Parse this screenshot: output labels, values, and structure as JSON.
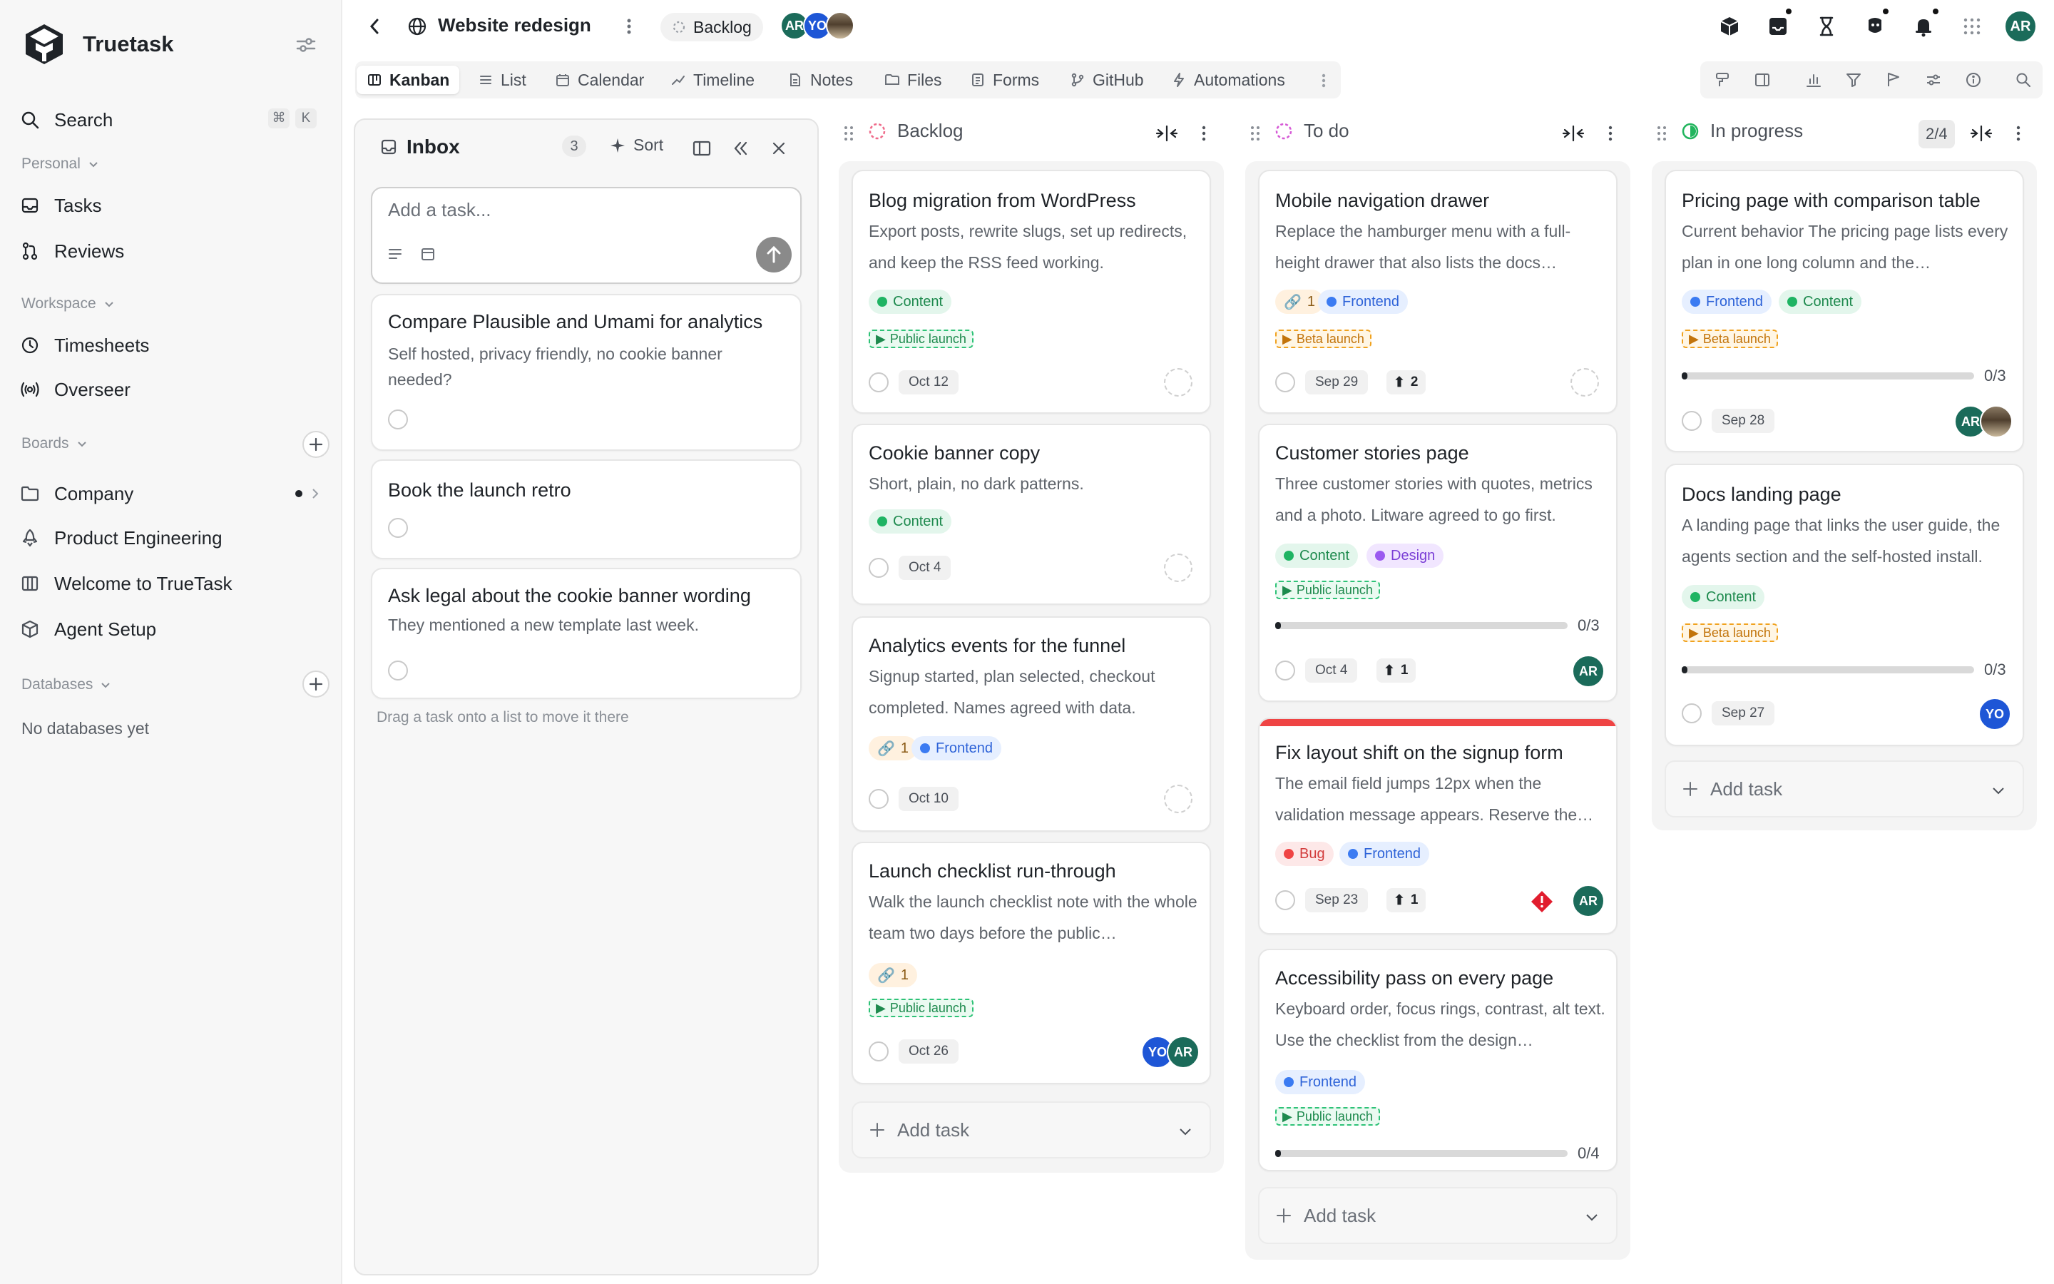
{
  "sidebar": {
    "brand": "Truetask",
    "search_label": "Search",
    "search_kbd": [
      "⌘",
      "K"
    ],
    "personal_label": "Personal",
    "personal_items": [
      {
        "label": "Tasks"
      },
      {
        "label": "Reviews"
      }
    ],
    "workspace_label": "Workspace",
    "workspace_items": [
      {
        "label": "Timesheets"
      },
      {
        "label": "Overseer"
      }
    ],
    "boards_label": "Boards",
    "boards": [
      {
        "label": "Company"
      },
      {
        "label": "Product Engineering"
      },
      {
        "label": "Welcome to TrueTask"
      },
      {
        "label": "Agent Setup"
      }
    ],
    "databases_label": "Databases",
    "databases_empty": "No databases yet"
  },
  "topbar": {
    "title": "Website redesign",
    "status_pill": "Backlog",
    "members": [
      "AR",
      "YO"
    ],
    "user_initials": "AR"
  },
  "views": {
    "tabs": [
      {
        "label": "Kanban",
        "active": true
      },
      {
        "label": "List"
      },
      {
        "label": "Calendar"
      },
      {
        "label": "Timeline"
      },
      {
        "label": "Notes"
      },
      {
        "label": "Files"
      },
      {
        "label": "Forms"
      },
      {
        "label": "GitHub"
      },
      {
        "label": "Automations"
      }
    ]
  },
  "inbox": {
    "title": "Inbox",
    "count": "3",
    "sort_label": "Sort",
    "add_placeholder": "Add a task...",
    "cards": [
      {
        "title": "Compare Plausible and Umami for analytics",
        "desc": "Self hosted, privacy friendly, no cookie banner needed?"
      },
      {
        "title": "Book the launch retro",
        "desc": ""
      },
      {
        "title": "Ask legal about the cookie banner wording",
        "desc": "They mentioned a new template last week."
      }
    ],
    "hint": "Drag a task onto a list to move it there"
  },
  "columns": {
    "backlog": {
      "title": "Backlog",
      "cards": [
        {
          "title": "Blog migration from WordPress",
          "desc": "Export posts, rewrite slugs, set up redirects, and keep the RSS feed working.",
          "tags": [
            "Content"
          ],
          "milestone": "Public launch",
          "date": "Oct 12"
        },
        {
          "title": "Cookie banner copy",
          "desc": "Short, plain, no dark patterns.",
          "tags": [
            "Content"
          ],
          "date": "Oct 4"
        },
        {
          "title": "Analytics events for the funnel",
          "desc": "Signup started, plan selected, checkout completed. Names agreed with data.",
          "links": "1",
          "tags": [
            "Frontend"
          ],
          "date": "Oct 10"
        },
        {
          "title": "Launch checklist run-through",
          "desc": "Walk the launch checklist note with the whole team two days before the public…",
          "links": "1",
          "milestone": "Public launch",
          "date": "Oct 26",
          "assignees": [
            "YO",
            "AR"
          ]
        }
      ],
      "add_label": "Add task"
    },
    "todo": {
      "title": "To do",
      "cards": [
        {
          "title": "Mobile navigation drawer",
          "desc": "Replace the hamburger menu with a full-height drawer that also lists the docs…",
          "links": "1",
          "tags": [
            "Frontend"
          ],
          "milestone": "Beta launch",
          "date": "Sep 29",
          "votes": "2"
        },
        {
          "title": "Customer stories page",
          "desc": "Three customer stories with quotes, metrics and a photo. Litware agreed to go first.",
          "tags": [
            "Content",
            "Design"
          ],
          "milestone": "Public launch",
          "progress": "0/3",
          "progress_value": 0,
          "date": "Oct 4",
          "votes": "1",
          "assignees": [
            "AR"
          ]
        },
        {
          "title": "Fix layout shift on the signup form",
          "desc": "The email field jumps 12px when the validation message appears. Reserve the…",
          "tags": [
            "Bug",
            "Frontend"
          ],
          "date": "Sep 23",
          "votes": "1",
          "assignees": [
            "AR"
          ]
        },
        {
          "title": "Accessibility pass on every page",
          "desc": "Keyboard order, focus rings, contrast, alt text. Use the checklist from the design…",
          "tags": [
            "Frontend"
          ],
          "milestone": "Public launch",
          "progress": "0/4",
          "progress_value": 0
        }
      ],
      "add_label": "Add task"
    },
    "inprogress": {
      "title": "In progress",
      "wip": "2/4",
      "cards": [
        {
          "title": "Pricing page with comparison table",
          "desc": "Current behavior The pricing page lists every plan in one long column and the…",
          "tags": [
            "Frontend",
            "Content"
          ],
          "milestone": "Beta launch",
          "progress": "0/3",
          "progress_value": 0,
          "date": "Sep 28",
          "assignees": [
            "AR"
          ]
        },
        {
          "title": "Docs landing page",
          "desc": "A landing page that links the user guide, the agents section and the self-hosted install.",
          "tags": [
            "Content"
          ],
          "milestone": "Beta launch",
          "progress": "0/3",
          "progress_value": 0,
          "date": "Sep 27",
          "assignees": [
            "YO"
          ]
        }
      ],
      "add_label": "Add task"
    }
  }
}
